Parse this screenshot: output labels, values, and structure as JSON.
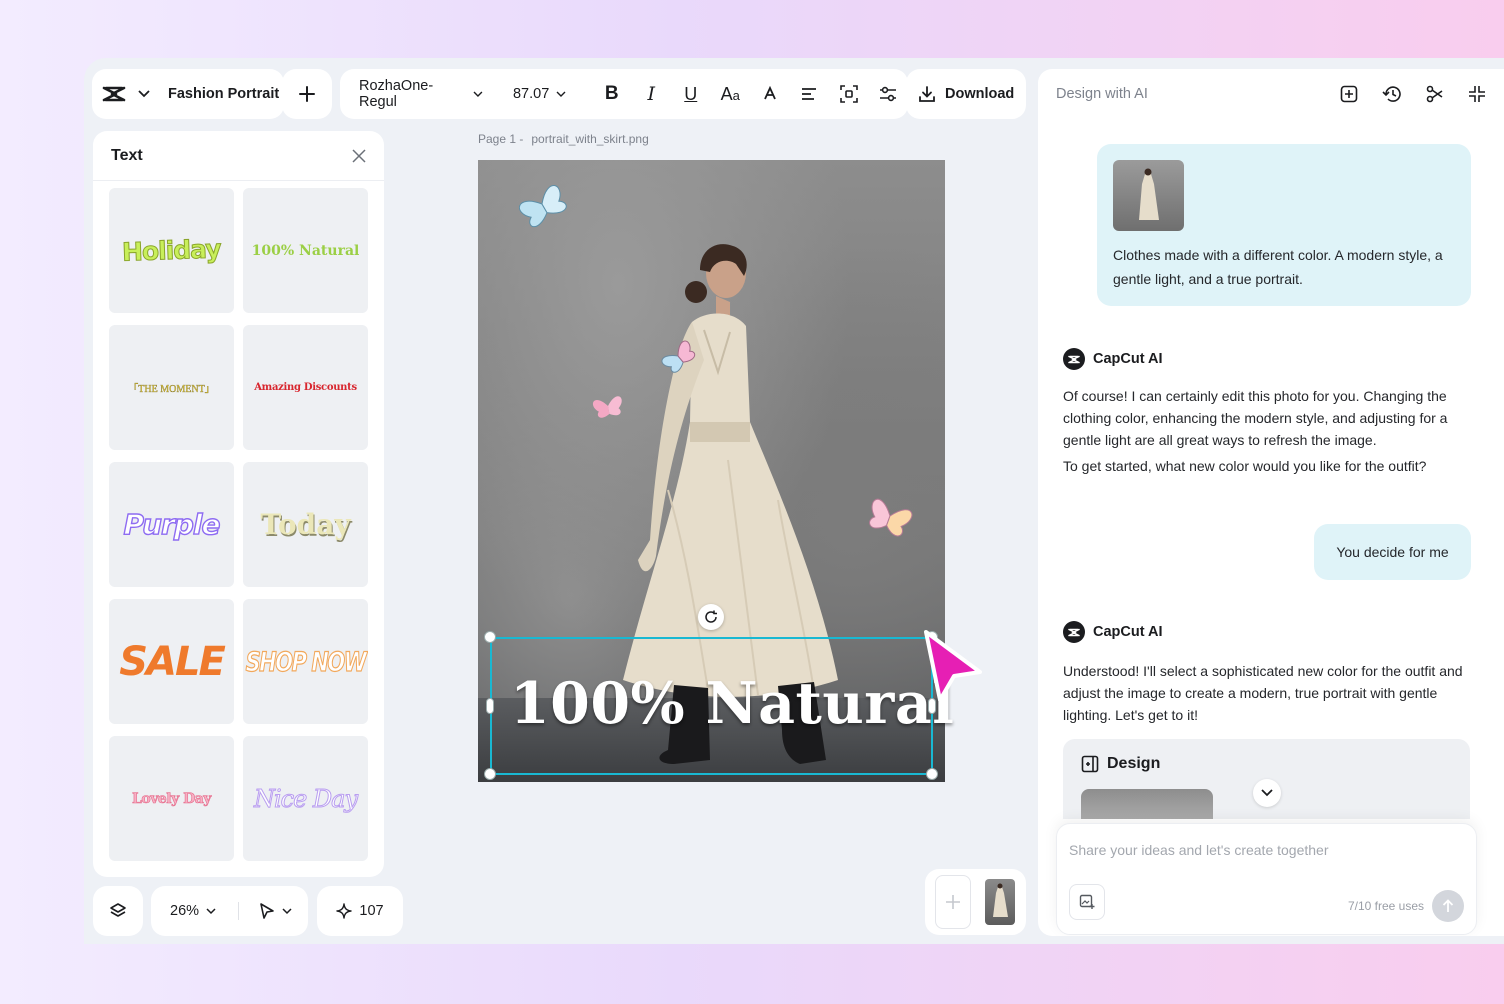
{
  "topbar": {
    "project_title": "Fashion Portrait",
    "font_name": "RozhaOne-Regul",
    "font_size": "87.07",
    "download_label": "Download"
  },
  "text_panel": {
    "title": "Text",
    "presets": [
      {
        "label": "Holiday",
        "color": "#c8ef5a"
      },
      {
        "label": "100% Natural",
        "color": "#9bcf45"
      },
      {
        "label": "「THE MOMENT」",
        "color": "#e8d24a"
      },
      {
        "label": "Amazing Discounts",
        "color": "#d8262e"
      },
      {
        "label": "Purple",
        "color": "#8e6cf2"
      },
      {
        "label": "Today",
        "color": "#ebe7b8"
      },
      {
        "label": "SALE",
        "color": "#ef7a2c"
      },
      {
        "label": "SHOP NOW",
        "color": "#f2a85b"
      },
      {
        "label": "Lovely Day",
        "color": "#e56a8a"
      },
      {
        "label": "Nice Day",
        "color": "#b99ef0"
      }
    ]
  },
  "bottom_controls": {
    "zoom": "26%",
    "credits": "107"
  },
  "canvas": {
    "page_label": "Page 1 -",
    "file_name": "portrait_with_skirt.png",
    "overlay_text": "100% Natural"
  },
  "ai_panel": {
    "title": "Design with AI",
    "user_message_1": "Clothes made with a different color. A modern style, a gentle light, and a true portrait.",
    "assistant_name": "CapCut AI",
    "assistant_message_1a": "Of course! I can certainly edit this photo for you. Changing the clothing color, enhancing the modern style, and adjusting for a gentle light are all great ways to refresh the image.",
    "assistant_message_1b": "To get started, what new color would you like for the outfit?",
    "user_message_2": "You decide for me",
    "assistant_message_2": "Understood! I'll select a sophisticated new color for the outfit and adjust the image to create a modern, true portrait with gentle lighting. Let's get to it!",
    "design_card_title": "Design",
    "prompt_placeholder": "Share your ideas and let's create together",
    "free_uses": "7/10 free uses"
  },
  "colors": {
    "selection": "#19b8d2",
    "cursor": "#e61fb4",
    "user_bubble": "#dff3f8"
  }
}
